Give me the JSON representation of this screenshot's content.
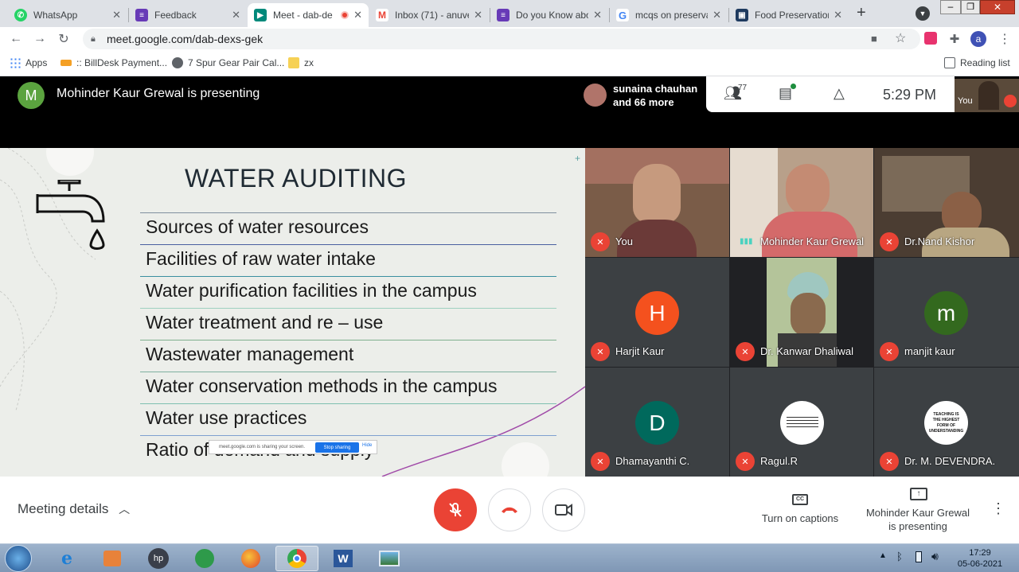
{
  "browser": {
    "tabs": [
      {
        "label": "WhatsApp",
        "color": "#25d366",
        "active": false
      },
      {
        "label": "Feedback",
        "color": "#673ab7",
        "active": false
      },
      {
        "label": "Meet - dab-de",
        "color": "#00897b",
        "active": true
      },
      {
        "label": "Inbox (71) - anuve",
        "color": "#ea4335",
        "active": false
      },
      {
        "label": "Do you Know abo",
        "color": "#673ab7",
        "active": false
      },
      {
        "label": "mcqs on preservat",
        "color": "#4285f4",
        "active": false
      },
      {
        "label": "Food Preservation",
        "color": "#1e3a5f",
        "active": false
      }
    ],
    "url": "meet.google.com/dab-dexs-gek",
    "profile_initial": "a",
    "bookmarks": {
      "apps": "Apps",
      "items": [
        ":: BillDesk Payment...",
        "7 Spur Gear Pair Cal...",
        "zx"
      ],
      "reading_list": "Reading list"
    }
  },
  "meet": {
    "presenter_initial": "M",
    "presenting_label": "Mohinder Kaur Grewal is presenting",
    "participants_chip": {
      "line1": "sunaina chauhan",
      "line2": "and 66 more"
    },
    "participant_count": "77",
    "clock": "5:29  PM",
    "self_label": "You",
    "slide": {
      "title": "WATER AUDITING",
      "items": [
        "Sources of water resources",
        "Facilities of raw water intake",
        "Water purification facilities in the campus",
        "Water treatment and re – use",
        "Wastewater management",
        "Water conservation methods in the campus",
        "Water use practices",
        "Ratio of demand and supply"
      ],
      "share_notice": "meet.google.com is sharing your screen.",
      "stop_sharing": "Stop sharing",
      "hide": "Hide"
    },
    "tiles": [
      {
        "name": "You",
        "initial": "",
        "color": "#7a5c48"
      },
      {
        "name": "Mohinder Kaur Grewal",
        "initial": "",
        "color": "#8a6f5a"
      },
      {
        "name": "Dr.Nand Kishor",
        "initial": "",
        "color": "#5b4a3c"
      },
      {
        "name": "Harjit Kaur",
        "initial": "H",
        "color": "#f4511e"
      },
      {
        "name": "Dr. Kanwar Dhaliwal",
        "initial": "",
        "color": "#6a7a5a"
      },
      {
        "name": "manjit kaur",
        "initial": "m",
        "color": "#33691e"
      },
      {
        "name": "Dhamayanthi C.",
        "initial": "D",
        "color": "#00695c"
      },
      {
        "name": "Ragul.R",
        "initial": "",
        "color": "#ffffff"
      },
      {
        "name": "Dr. M. DEVENDRA.",
        "initial": "",
        "color": "#ffffff"
      }
    ],
    "devendra_quote": "TEACHING IS THE HIGHEST FORM OF UNDERSTANDING",
    "bottom": {
      "meeting_details": "Meeting details",
      "captions": "Turn on captions",
      "present_line1": "Mohinder Kaur Grewal",
      "present_line2": "is presenting"
    }
  },
  "taskbar": {
    "time": "17:29",
    "date": "05-06-2021"
  },
  "colors": {
    "meet_red": "#ea4335",
    "accent_blue": "#1a73e8"
  }
}
